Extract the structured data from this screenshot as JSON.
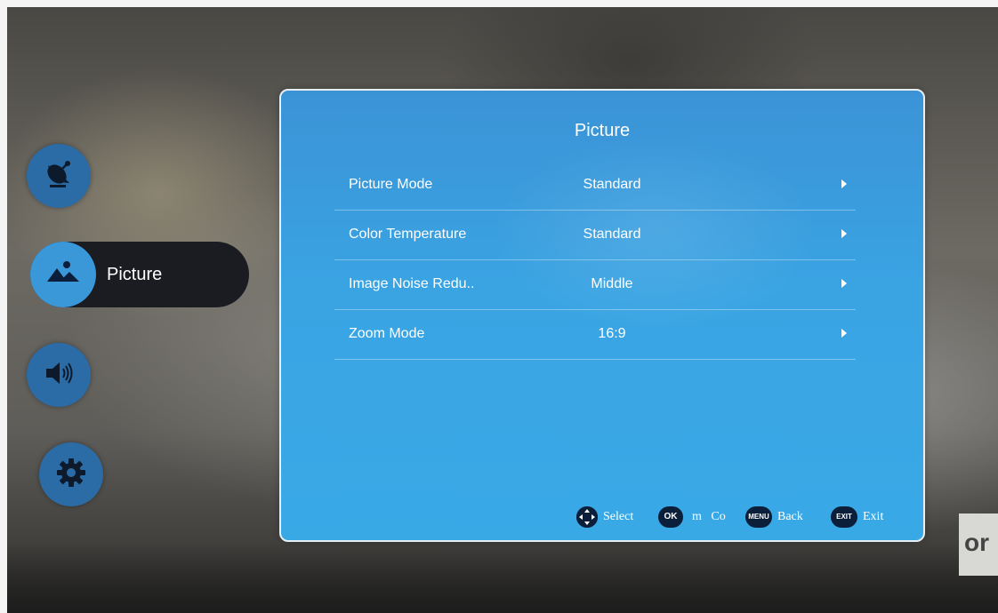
{
  "sidebar": {
    "items": [
      {
        "icon": "satellite-dish-icon"
      },
      {
        "icon": "landscape-picture-icon",
        "label": "Picture",
        "active": true
      },
      {
        "icon": "speaker-volume-icon"
      },
      {
        "icon": "gear-icon"
      }
    ]
  },
  "panel": {
    "title": "Picture",
    "rows": [
      {
        "name": "Picture Mode",
        "value": "Standard"
      },
      {
        "name": "Color Temperature",
        "value": "Standard"
      },
      {
        "name": "Image Noise Redu..",
        "value": "Middle"
      },
      {
        "name": "Zoom Mode",
        "value": "16:9"
      }
    ]
  },
  "footer": {
    "select_label": "Select",
    "ok_key": "OK",
    "confirm_fragment": "m   Co",
    "menu_key": "MENU",
    "back_label": "Back",
    "exit_key": "EXIT",
    "exit_label": "Exit"
  },
  "background": {
    "logo_fragment": "or"
  },
  "colors": {
    "panel": "#3aa4e3",
    "nav_button": "#2b6ca6",
    "nav_active_pill": "#1a1c22",
    "nav_active_bubble": "#3a98d8"
  }
}
